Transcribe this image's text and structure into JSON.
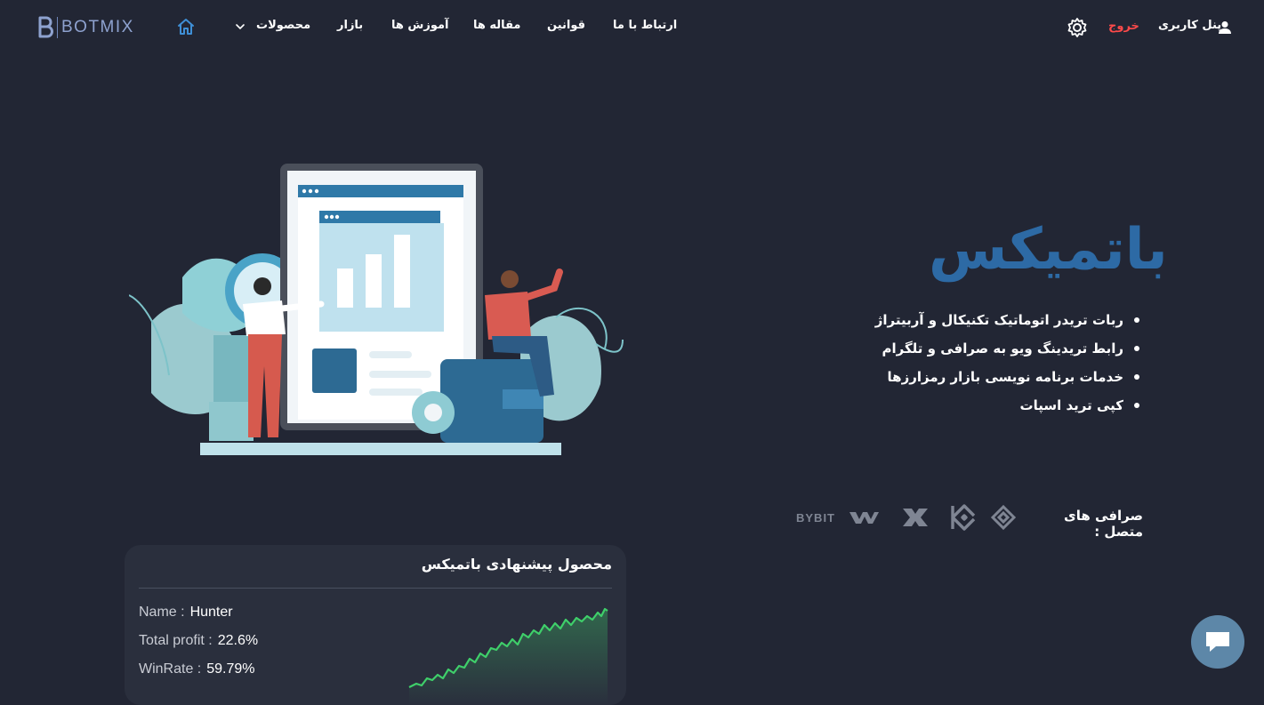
{
  "brand": {
    "logo_text": "BOTMIX",
    "hero_title": "باتمیکس"
  },
  "nav": {
    "items": [
      {
        "label": "محصولات",
        "id": "products"
      },
      {
        "label": "بازار",
        "id": "market"
      },
      {
        "label": "آموزش ها",
        "id": "tutorials"
      },
      {
        "label": "مقاله ها",
        "id": "articles"
      },
      {
        "label": "قوانین",
        "id": "rules"
      },
      {
        "label": "ارتباط با ما",
        "id": "contact"
      }
    ],
    "user_panel": "پنل کاربری",
    "logout": "خروج"
  },
  "features": [
    "ربات تریدر اتوماتیک تکنیکال و آربیتراژ",
    "رابط تریدینگ ویو به صرافی و تلگرام",
    "خدمات برنامه نویسی بازار رمزارزها",
    "کپی ترید اسپات"
  ],
  "exchanges": {
    "label": "صرافی های متصل :",
    "items": [
      "binance-icon",
      "kucoin-icon",
      "okx-icon",
      "woo-icon",
      "bybit-icon"
    ],
    "bybit_text": "BYBIT"
  },
  "product": {
    "title": "محصول پیشنهادی باتمیکس",
    "name_label": "Name :",
    "name_value": "Hunter",
    "profit_label": "Total profit :",
    "profit_value": "22.6%",
    "winrate_label": "WinRate :",
    "winrate_value": "59.79%"
  },
  "colors": {
    "background": "#222634",
    "accent": "#2d6aa5",
    "logout": "#ff4a4a",
    "chart_line": "#3fcf6a"
  }
}
